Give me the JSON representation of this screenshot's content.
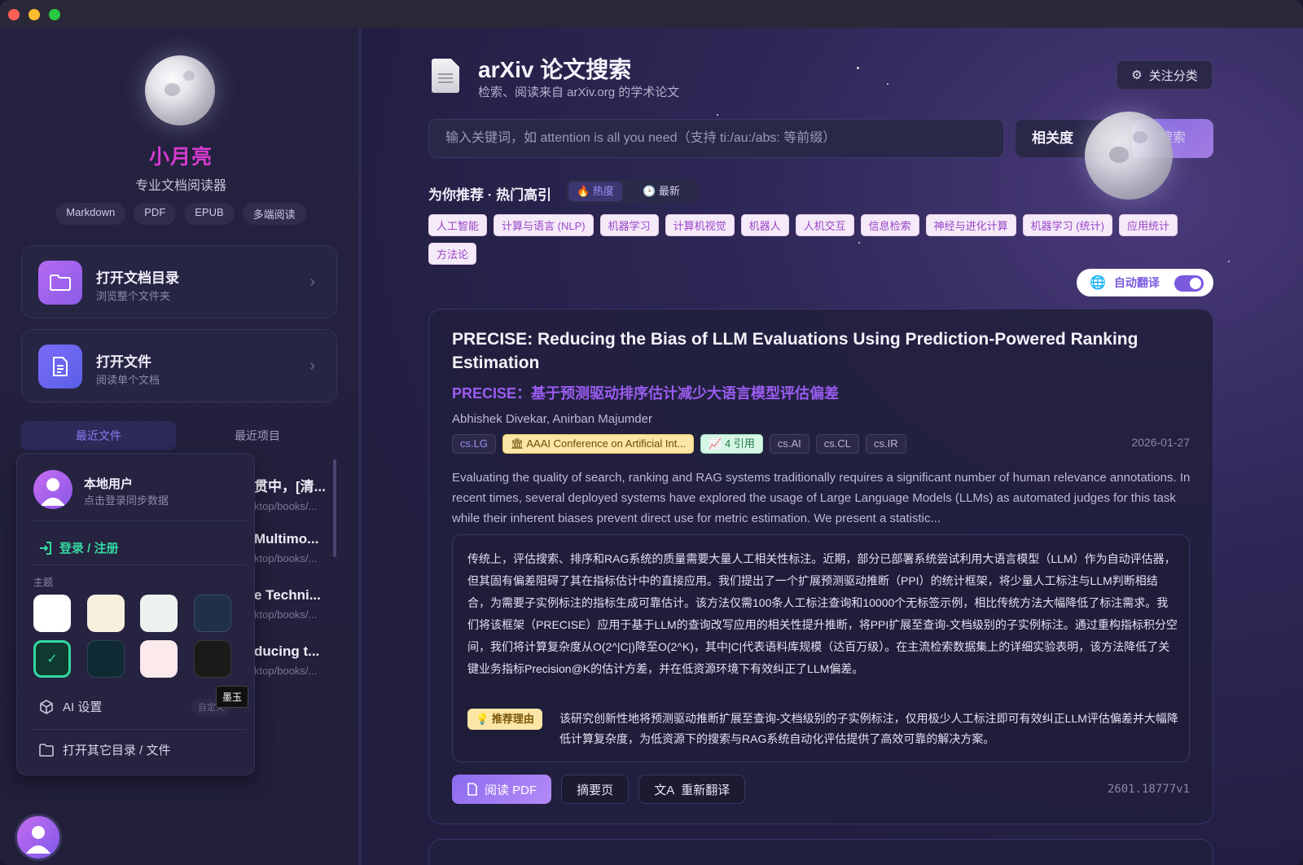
{
  "sidebar": {
    "brand_name": "小月亮",
    "brand_subtitle": "专业文档阅读器",
    "formats": [
      "Markdown",
      "PDF",
      "EPUB",
      "多端阅读"
    ],
    "open_dir": {
      "title": "打开文档目录",
      "subtitle": "浏览整个文件夹"
    },
    "open_file": {
      "title": "打开文件",
      "subtitle": "阅读单个文档"
    },
    "tabs": {
      "recent_files": "最近文件",
      "recent_projects": "最近项目"
    },
    "recent_items": [
      {
        "title": "贯中，[清...",
        "path": "ktop/books/..."
      },
      {
        "title": "Multimo...",
        "path": "ktop/books/..."
      },
      {
        "title": "e Techni...",
        "path": "ktop/books/..."
      },
      {
        "title": "ducing t...",
        "path": "ktop/books/..."
      }
    ],
    "user_menu": {
      "username": "本地用户",
      "user_subtitle": "点击登录同步数据",
      "login": "登录 / 注册",
      "theme_label": "主题",
      "themes": [
        {
          "color": "#ffffff",
          "selected": false
        },
        {
          "color": "#f8efdf",
          "selected": false
        },
        {
          "color": "#eef2ee",
          "selected": false
        },
        {
          "color": "#1f3048",
          "selected": false
        },
        {
          "color": "#0e3a30",
          "selected": true
        },
        {
          "color": "#0f2a34",
          "selected": false
        },
        {
          "color": "#fbe9ec",
          "selected": false
        },
        {
          "color": "#1c1a18",
          "selected": false
        }
      ],
      "ai_settings": "AI 设置",
      "custom": "自定义",
      "open_other": "打开其它目录 / 文件",
      "tooltip": "墨玉"
    }
  },
  "main": {
    "title": "arXiv 论文搜索",
    "subtitle": "检索、阅读来自 arXiv.org 的学术论文",
    "follow_button": "关注分类",
    "search_placeholder": "输入关键词，如 attention is all you need（支持 ti:/au:/abs: 等前缀）",
    "sort_value": "相关度",
    "search_button": "搜索",
    "recommend_title": "为你推荐 · 热门高引",
    "toggle_hot": "热度",
    "toggle_new": "最新",
    "categories": [
      "人工智能",
      "计算与语言 (NLP)",
      "机器学习",
      "计算机视觉",
      "机器人",
      "人机交互",
      "信息检索",
      "神经与进化计算",
      "机器学习 (统计)",
      "应用统计",
      "方法论"
    ],
    "auto_translate": "自动翻译",
    "auto_translate_on": true,
    "paper": {
      "title": "PRECISE: Reducing the Bias of LLM Evaluations Using Prediction-Powered Ranking Estimation",
      "title_zh": "PRECISE：基于预测驱动排序估计减少大语言模型评估偏差",
      "authors": "Abhishek Divekar, Anirban Majumder",
      "primary_cat": "cs.LG",
      "venue": "AAAI Conference on Artificial Int...",
      "citations": "4 引用",
      "other_cats": [
        "cs.AI",
        "cs.CL",
        "cs.IR"
      ],
      "date": "2026-01-27",
      "abstract": "Evaluating the quality of search, ranking and RAG systems traditionally requires a significant number of human relevance annotations. In recent times, several deployed systems have explored the usage of Large Language Models (LLMs) as automated judges for this task while their inherent biases prevent direct use for metric estimation. We present a statistic...",
      "translation": "传统上，评估搜索、排序和RAG系统的质量需要大量人工相关性标注。近期，部分已部署系统尝试利用大语言模型（LLM）作为自动评估器，但其固有偏差阻碍了其在指标估计中的直接应用。我们提出了一个扩展预测驱动推断（PPI）的统计框架，将少量人工标注与LLM判断相结合，为需要子实例标注的指标生成可靠估计。该方法仅需100条人工标注查询和10000个无标签示例，相比传统方法大幅降低了标注需求。我们将该框架（PRECISE）应用于基于LLM的查询改写应用的相关性提升推断，将PPI扩展至查询-文档级别的子实例标注。通过重构指标积分空间，我们将计算复杂度从O(2^|C|)降至O(2^K)，其中|C|代表语料库规模（达百万级）。在主流检索数据集上的详细实验表明，该方法降低了关键业务指标Precision@K的估计方差，并在低资源环境下有效纠正了LLM偏差。",
      "reason_label": "推荐理由",
      "reason": "该研究创新性地将预测驱动推断扩展至查询-文档级别的子实例标注，仅用极少人工标注即可有效纠正LLM评估偏差并大幅降低计算复杂度，为低资源下的搜索与RAG系统自动化评估提供了高效可靠的解决方案。",
      "read_pdf": "阅读 PDF",
      "abstract_page": "摘要页",
      "retranslate": "重新翻译",
      "arxiv_id": "2601.18777v1"
    }
  }
}
